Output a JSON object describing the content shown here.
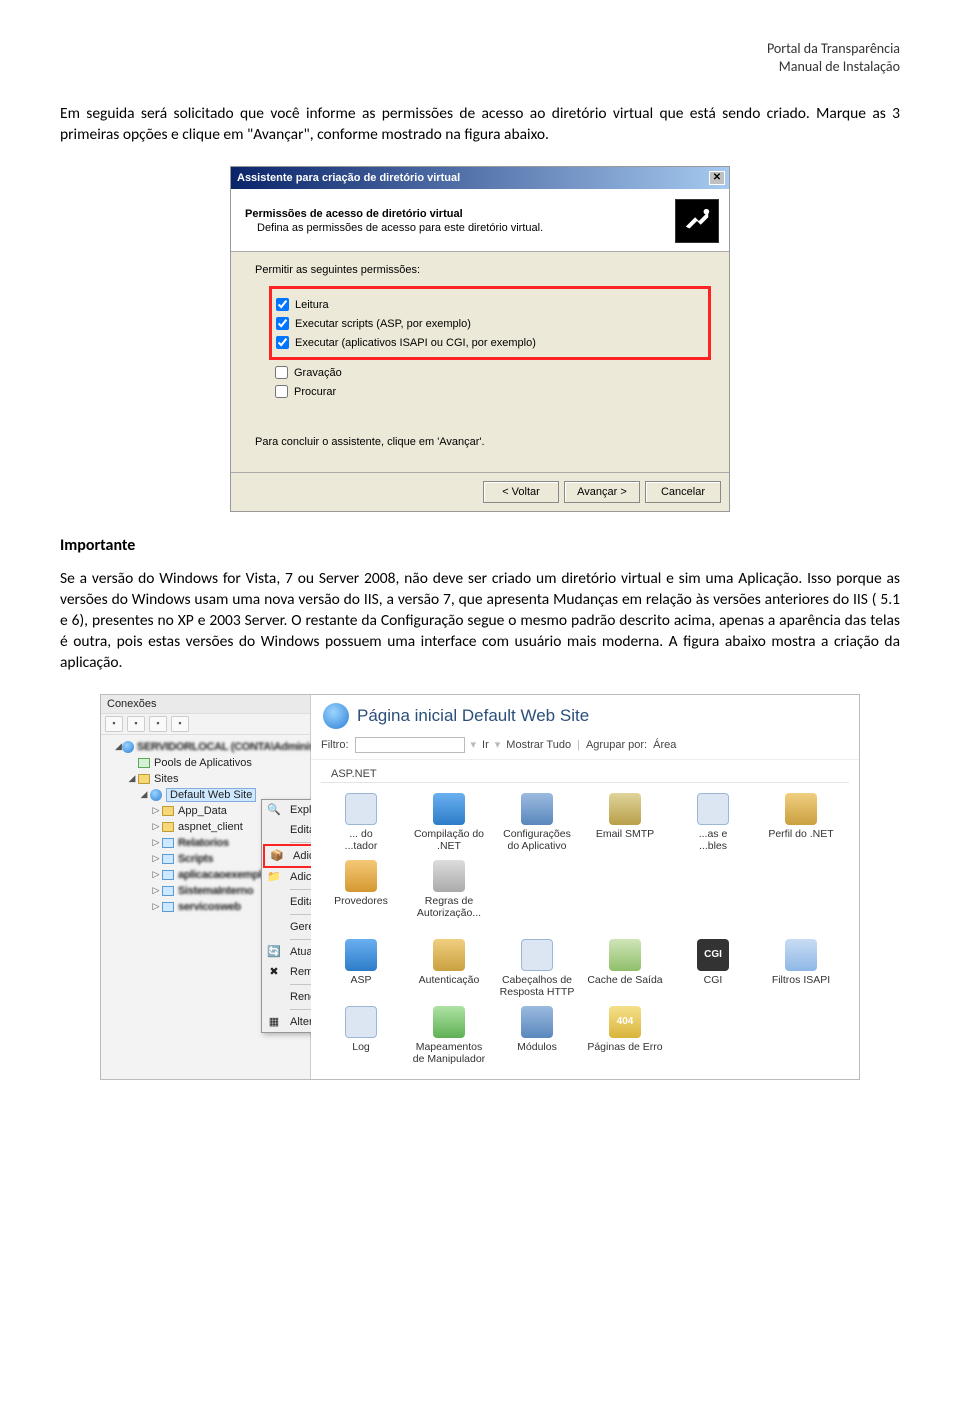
{
  "header": {
    "line1": "Portal da Transparência",
    "line2": "Manual de Instalação"
  },
  "para1": "Em seguida será solicitado que você informe as permissões de acesso ao diretório virtual que está sendo criado. Marque as 3 primeiras opções e clique em \"Avançar\", conforme mostrado na figura abaixo.",
  "dialog": {
    "title": "Assistente para criação de diretório virtual",
    "header_title": "Permissões de acesso de diretório virtual",
    "header_sub": "Defina as permissões de acesso para este diretório virtual.",
    "perm_label": "Permitir as seguintes permissões:",
    "perm": {
      "leitura": "Leitura",
      "scripts": "Executar scripts (ASP, por exemplo)",
      "isapi": "Executar (aplicativos ISAPI ou CGI, por exemplo)",
      "gravacao": "Gravação",
      "procurar": "Procurar"
    },
    "finish": "Para concluir o assistente, clique em 'Avançar'.",
    "btn_back": "< Voltar",
    "btn_next": "Avançar >",
    "btn_cancel": "Cancelar"
  },
  "importante_heading": "Importante",
  "para2": "Se a versão do Windows for Vista, 7 ou Server 2008, não deve ser criado um diretório virtual e sim uma Aplicação. Isso porque as versões do Windows usam uma nova versão do IIS, a versão 7, que apresenta Mudanças em relação às versões anteriores do IIS ( 5.1 e 6), presentes no XP e 2003 Server. O restante da Configuração segue o mesmo padrão descrito acima, apenas a aparência das telas é outra, pois estas versões do Windows possuem uma interface com usuário mais moderna. A figura abaixo mostra a criação da aplicação.",
  "iis": {
    "left_title": "Conexões",
    "tree": {
      "server": "SERVIDORLOCAL (CONTA\\Administrador)",
      "pools": "Pools de Aplicativos",
      "sites": "Sites",
      "default": "Default Web Site",
      "children": [
        "App_Data",
        "aspnet_client",
        "Relatorios",
        "Scripts",
        "aplicacaoexemplo",
        "SistemaInterno",
        "servicosweb"
      ]
    },
    "ctx": {
      "explorar": "Explorar",
      "editar_perm": "Editar Permissões...",
      "add_app": "Adicionar Aplicativo...",
      "add_dir": "Adicionar Diretório Virtual...",
      "editar_lig": "Editar Ligações...",
      "gerenciar": "Gerenciar Site",
      "atualizar": "Atualizar",
      "remover": "Remover",
      "renomear": "Renomear",
      "alternar": "Alternar para Exibição de Conteúdo"
    },
    "main_title": "Página inicial Default Web Site",
    "filter_label": "Filtro:",
    "ir": "Ir",
    "mostrar_tudo": "Mostrar Tudo",
    "agrupar": "Agrupar por:",
    "agrupar_val": "Área",
    "cat_aspnet": "ASP.NET",
    "features_a": [
      {
        "label": "... do\n...tador",
        "cls": "c-paper"
      },
      {
        "label": "Compilação do\n.NET",
        "cls": "c-blue"
      },
      {
        "label": "Configurações\ndo Aplicativo",
        "cls": "c-gear"
      },
      {
        "label": "Email SMTP",
        "cls": "c-mail"
      },
      {
        "label": "...as e\n...bles",
        "cls": "c-paper"
      },
      {
        "label": "Perfil do .NET",
        "cls": "c-key"
      },
      {
        "label": "Provedores",
        "cls": "c-db"
      },
      {
        "label": "Regras de\nAutorização...",
        "cls": "c-lock"
      }
    ],
    "features_b": [
      {
        "label": "ASP",
        "cls": "c-blue"
      },
      {
        "label": "Autenticação",
        "cls": "c-key"
      },
      {
        "label": "Cabeçalhos de\nResposta HTTP",
        "cls": "c-paper"
      },
      {
        "label": "Cache de Saída",
        "cls": "c-cache"
      },
      {
        "label": "CGI",
        "cls": "c-dark",
        "txt": "CGI"
      },
      {
        "label": "Filtros ISAPI",
        "cls": "c-link"
      },
      {
        "label": "Log",
        "cls": "c-paper"
      },
      {
        "label": "Mapeamentos\nde Manipulador",
        "cls": "c-green"
      },
      {
        "label": "Módulos",
        "cls": "c-gear"
      },
      {
        "label": "Páginas de Erro",
        "cls": "c-404",
        "txt": "404"
      }
    ]
  }
}
